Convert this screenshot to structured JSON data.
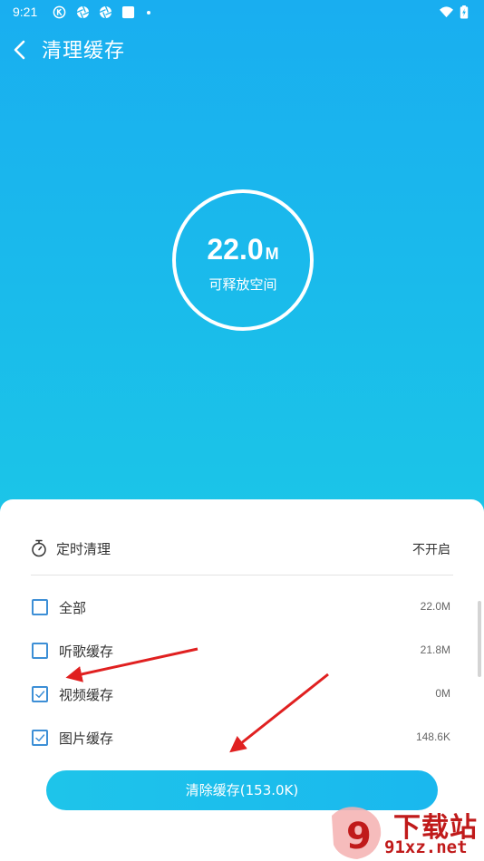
{
  "status_bar": {
    "time": "9:21",
    "icons": [
      "k-app-icon",
      "aperture-icon",
      "aperture-icon",
      "square-app-icon",
      "notification-dot-icon",
      "wifi-icon",
      "battery-charging-icon"
    ]
  },
  "header": {
    "title": "清理缓存",
    "back_icon": "chevron-left-icon"
  },
  "summary": {
    "amount": "22.0",
    "unit": "M",
    "caption": "可释放空间"
  },
  "timer": {
    "icon": "stopwatch-icon",
    "label": "定时清理",
    "value": "不开启"
  },
  "cache_items": [
    {
      "label": "全部",
      "size": "22.0M",
      "checked": false
    },
    {
      "label": "听歌缓存",
      "size": "21.8M",
      "checked": false
    },
    {
      "label": "视频缓存",
      "size": "0M",
      "checked": true
    },
    {
      "label": "图片缓存",
      "size": "148.6K",
      "checked": true
    }
  ],
  "clear_button": {
    "label": "清除缓存(153.0K)"
  },
  "watermark": {
    "logo_text": "9",
    "text": "下载站",
    "domain": "91xz.net"
  },
  "colors": {
    "accent": "#1ab8ee",
    "checkbox": "#3d8fd6",
    "annotation_arrow": "#e02020"
  }
}
